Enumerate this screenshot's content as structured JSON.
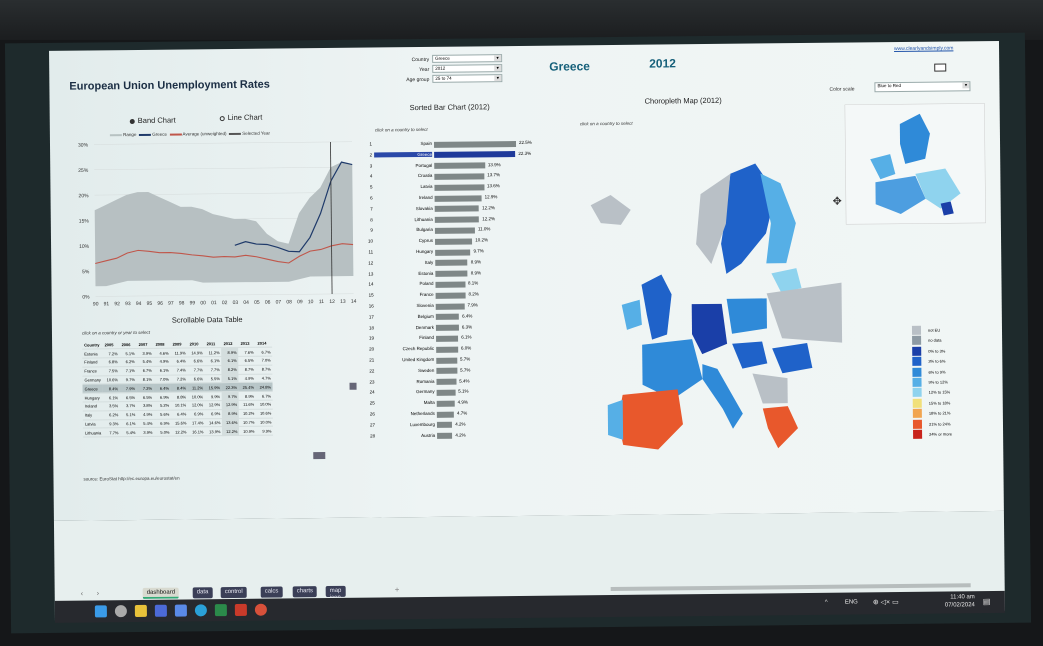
{
  "header": {
    "title": "European Union Unemployment Rates",
    "country_label": "Country",
    "country_value": "Greece",
    "year_label": "Year",
    "year_value": "2012",
    "age_label": "Age group",
    "age_value": "25 to 74",
    "big_country": "Greece",
    "big_year": "2012",
    "link": "www.clearlyandsimply.com"
  },
  "band_panel": {
    "band_label": "Band Chart",
    "line_label": "Line Chart",
    "legend": [
      "Range",
      "Greece",
      "Average (unweighted)",
      "Selected Year"
    ]
  },
  "chart_data": [
    {
      "type": "area",
      "title": "",
      "y_ticks": [
        "30%",
        "25%",
        "20%",
        "15%",
        "10%",
        "5%",
        "0%"
      ],
      "x_ticks": [
        "90",
        "91",
        "92",
        "93",
        "94",
        "95",
        "96",
        "97",
        "98",
        "99",
        "00",
        "01",
        "02",
        "03",
        "04",
        "05",
        "06",
        "07",
        "08",
        "09",
        "10",
        "11",
        "12",
        "13",
        "14"
      ],
      "ylim": [
        0,
        30
      ],
      "x": [
        1990,
        1991,
        1992,
        1993,
        1994,
        1995,
        1996,
        1997,
        1998,
        1999,
        2000,
        2001,
        2002,
        2003,
        2004,
        2005,
        2006,
        2007,
        2008,
        2009,
        2010,
        2011,
        2012,
        2013,
        2014
      ],
      "series": [
        {
          "name": "Range",
          "type": "band",
          "low": [
            2.0,
            2.0,
            2.5,
            3.0,
            3.0,
            3.0,
            3.0,
            3.0,
            3.0,
            3.0,
            2.5,
            2.5,
            2.5,
            2.5,
            2.5,
            2.5,
            2.5,
            2.5,
            2.5,
            3.0,
            3.5,
            3.5,
            3.5,
            3.5,
            3.5
          ],
          "high": [
            17,
            18,
            19,
            20,
            20.5,
            20.5,
            19.5,
            18.5,
            17.5,
            17.5,
            17,
            16,
            15.5,
            15,
            15,
            14.5,
            12,
            10.5,
            10,
            16,
            19,
            21,
            25,
            26,
            25.5
          ]
        },
        {
          "name": "Greece",
          "values": [
            null,
            null,
            null,
            null,
            null,
            null,
            null,
            null,
            null,
            null,
            null,
            null,
            null,
            9.8,
            10.5,
            10.0,
            9.9,
            9.3,
            8.5,
            8.4,
            11.2,
            15.9,
            22.3,
            26.0,
            25.5
          ]
        },
        {
          "name": "Average (unweighted)",
          "values": [
            6.5,
            7.0,
            7.5,
            8.5,
            9.0,
            8.8,
            8.5,
            8.5,
            8.3,
            8.0,
            7.8,
            7.5,
            7.6,
            7.5,
            7.8,
            7.5,
            7.0,
            6.5,
            6.2,
            7.5,
            8.5,
            8.8,
            9.5,
            9.9,
            9.7
          ]
        },
        {
          "name": "Selected Year",
          "x": 2012
        }
      ]
    },
    {
      "type": "bar",
      "title": "Sorted Bar Chart (2012)",
      "note": "click on a country to select",
      "ranks": [
        1,
        2,
        3,
        4,
        5,
        6,
        7,
        8,
        9,
        10,
        11,
        12,
        13,
        14,
        15,
        16,
        17,
        18,
        19,
        20,
        21,
        22,
        23,
        24,
        25,
        26,
        27,
        28
      ],
      "categories": [
        "Spain",
        "Greece",
        "Portugal",
        "Croatia",
        "Latvia",
        "Ireland",
        "Slovakia",
        "Lithuania",
        "Bulgaria",
        "Cyprus",
        "Hungary",
        "Italy",
        "Estonia",
        "Poland",
        "France",
        "Slovenia",
        "Belgium",
        "Denmark",
        "Finland",
        "Czech Republic",
        "United Kingdom",
        "Sweden",
        "Romania",
        "Germany",
        "Malta",
        "Netherlands",
        "Luxembourg",
        "Austria"
      ],
      "values": [
        22.5,
        22.3,
        13.9,
        13.7,
        13.6,
        12.9,
        12.2,
        12.2,
        11.0,
        10.2,
        9.7,
        8.9,
        8.9,
        8.1,
        8.2,
        7.9,
        6.4,
        6.3,
        6.1,
        6.0,
        5.7,
        5.7,
        5.4,
        5.1,
        4.9,
        4.7,
        4.2,
        4.2
      ],
      "labels": [
        "22.5%",
        "22.3%",
        "13.9%",
        "13.7%",
        "13.6%",
        "12.9%",
        "12.2%",
        "12.2%",
        "11.0%",
        "10.2%",
        "9.7%",
        "8.9%",
        "8.9%",
        "8.1%",
        "8.2%",
        "7.9%",
        "6.4%",
        "6.3%",
        "6.1%",
        "6.0%",
        "5.7%",
        "5.7%",
        "5.4%",
        "5.1%",
        "4.9%",
        "4.7%",
        "4.2%",
        "4.2%"
      ],
      "highlight": "Greece",
      "xlim": [
        0,
        22.5
      ]
    }
  ],
  "table": {
    "title": "Scrollable Data Table",
    "note": "click on a country or year to select",
    "columns": [
      "Country",
      "2005",
      "2006",
      "2007",
      "2008",
      "2009",
      "2010",
      "2011",
      "2012",
      "2013",
      "2014"
    ],
    "rows": [
      [
        "Estonia",
        "7.2%",
        "5.1%",
        "3.9%",
        "4.6%",
        "11.9%",
        "14.9%",
        "11.2%",
        "8.9%",
        "7.6%",
        "6.7%"
      ],
      [
        "Finland",
        "6.8%",
        "6.2%",
        "5.4%",
        "4.9%",
        "6.4%",
        "6.6%",
        "6.1%",
        "6.1%",
        "6.5%",
        "7.0%"
      ],
      [
        "France",
        "7.5%",
        "7.1%",
        "6.7%",
        "6.1%",
        "7.4%",
        "7.7%",
        "7.7%",
        "8.2%",
        "8.7%",
        "8.7%"
      ],
      [
        "Germany",
        "10.6%",
        "9.7%",
        "8.1%",
        "7.0%",
        "7.2%",
        "6.6%",
        "5.5%",
        "5.1%",
        "4.9%",
        "4.7%"
      ],
      [
        "Greece",
        "8.4%",
        "7.9%",
        "7.2%",
        "6.4%",
        "8.4%",
        "11.2%",
        "15.9%",
        "22.3%",
        "25.4%",
        "24.8%"
      ],
      [
        "Hungary",
        "6.1%",
        "6.5%",
        "6.5%",
        "6.9%",
        "8.8%",
        "10.0%",
        "9.9%",
        "9.7%",
        "8.9%",
        "6.7%"
      ],
      [
        "Ireland",
        "3.5%",
        "3.7%",
        "3.8%",
        "5.2%",
        "10.1%",
        "12.0%",
        "12.9%",
        "12.9%",
        "11.6%",
        "10.0%"
      ],
      [
        "Italy",
        "6.2%",
        "5.1%",
        "4.9%",
        "5.6%",
        "6.4%",
        "6.9%",
        "6.9%",
        "8.9%",
        "10.2%",
        "10.6%"
      ],
      [
        "Latvia",
        "9.3%",
        "6.1%",
        "5.4%",
        "6.9%",
        "15.6%",
        "17.4%",
        "14.6%",
        "13.6%",
        "10.7%",
        "10.0%"
      ],
      [
        "Lithuania",
        "7.7%",
        "5.4%",
        "3.9%",
        "5.0%",
        "12.2%",
        "16.1%",
        "13.9%",
        "12.2%",
        "10.9%",
        "9.9%"
      ]
    ],
    "source": "source: EuroStat    http://ec.europa.eu/eurostat/en"
  },
  "map": {
    "title": "Choropleth Map (2012)",
    "note": "click on a country to select",
    "scale_label": "Color scale",
    "scale_value": "Blue to Red",
    "legend": [
      {
        "label": "not EU",
        "color": "#b9c0c6"
      },
      {
        "label": "no data",
        "color": "#8d9aa3"
      },
      {
        "label": "0% to 3%",
        "color": "#1a3fa8"
      },
      {
        "label": "3% to 6%",
        "color": "#1f62c9"
      },
      {
        "label": "6% to 9%",
        "color": "#2f8ad8"
      },
      {
        "label": "9% to 12%",
        "color": "#56afe6"
      },
      {
        "label": "12% to 15%",
        "color": "#8fd3ee"
      },
      {
        "label": "15% to 18%",
        "color": "#f1e07a"
      },
      {
        "label": "18% to 21%",
        "color": "#f1a550"
      },
      {
        "label": "21% to 24%",
        "color": "#e8582c"
      },
      {
        "label": "24% or more",
        "color": "#c8241c"
      }
    ]
  },
  "tabs": [
    "dashboard",
    "data",
    "control",
    "calcs",
    "charts",
    "map icon"
  ],
  "taskbar": {
    "lang": "ENG",
    "time": "11:40 am",
    "date": "07/02/2024"
  }
}
